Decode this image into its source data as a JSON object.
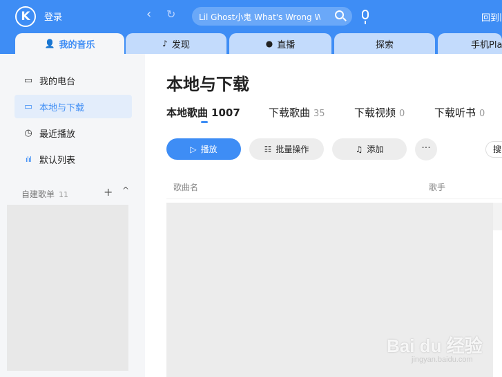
{
  "topbar": {
    "logo_letter": "K",
    "login_label": "登录",
    "back_glyph": "‹",
    "refresh_glyph": "↻",
    "search_value": "Lil Ghost小鬼 What's Wrong W",
    "back_to_label": "回到旧"
  },
  "tabs": [
    {
      "label": "我的音乐",
      "icon": "person-icon",
      "glyph": "👤",
      "active": true
    },
    {
      "label": "发现",
      "icon": "music-note-icon",
      "glyph": "♪"
    },
    {
      "label": "直播",
      "icon": "live-icon",
      "glyph": "●"
    },
    {
      "label": "探索"
    },
    {
      "label": "手机Pla"
    }
  ],
  "sidebar": {
    "items": [
      {
        "label": "我的电台",
        "icon": "radio-icon",
        "glyph": "▭"
      },
      {
        "label": "本地与下载",
        "icon": "monitor-icon",
        "glyph": "▭",
        "active": true
      },
      {
        "label": "最近播放",
        "icon": "clock-icon",
        "glyph": "◷"
      },
      {
        "label": "默认列表",
        "icon": "waveform-icon",
        "glyph": "ılıl"
      }
    ],
    "playlist_header": "自建歌单",
    "playlist_count": "11",
    "add_glyph": "+",
    "collapse_glyph": "^"
  },
  "main": {
    "title": "本地与下载",
    "subtabs": [
      {
        "label": "本地歌曲",
        "count": "1007",
        "active": true
      },
      {
        "label": "下载歌曲",
        "count": "35"
      },
      {
        "label": "下载视频",
        "count": "0"
      },
      {
        "label": "下载听书",
        "count": "0"
      }
    ],
    "buttons": {
      "play": "播放",
      "batch": "批量操作",
      "add": "添加",
      "more": "···",
      "cut_off": "搜"
    },
    "columns": {
      "song": "歌曲名",
      "artist": "歌手"
    }
  },
  "watermark": {
    "logo": "Bai du 经验",
    "url": "jingyan.baidu.com"
  },
  "colors": {
    "accent": "#3e8df5",
    "tab_inactive": "#c3dbfc",
    "active_bg": "#e3edfb"
  }
}
